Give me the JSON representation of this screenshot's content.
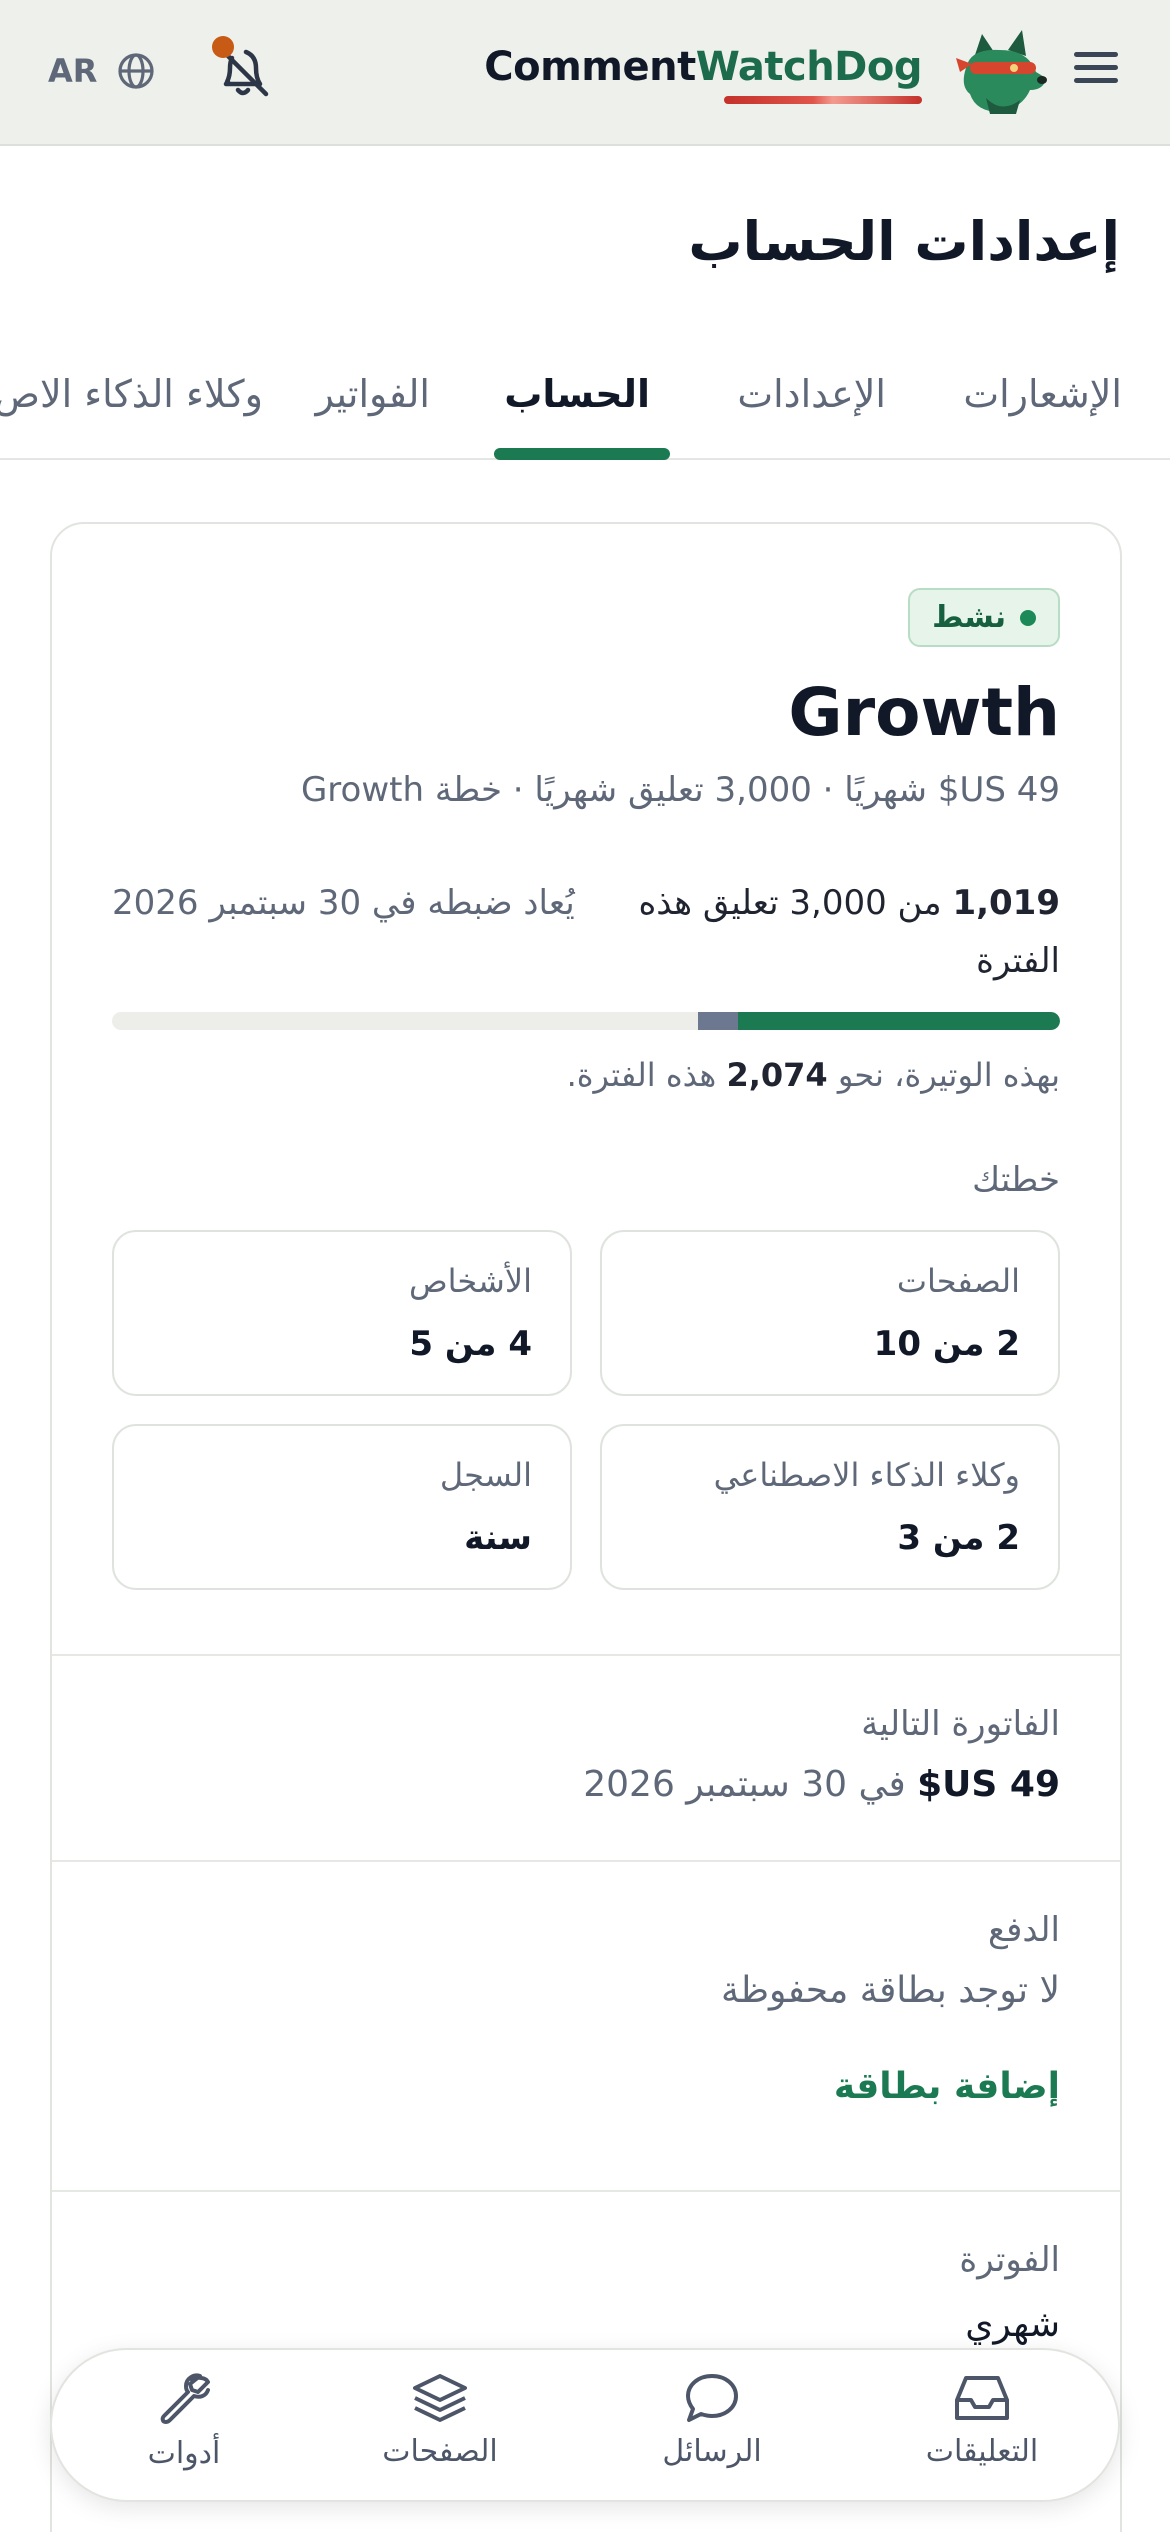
{
  "header": {
    "brand_part1": "Comment",
    "brand_part2": "WatchDog",
    "language": "AR"
  },
  "page_title": "إعدادات الحساب",
  "tabs": [
    {
      "label": "الإشعارات",
      "active": false
    },
    {
      "label": "الإعدادات",
      "active": false
    },
    {
      "label": "الحساب",
      "active": true
    },
    {
      "label": "الفواتير",
      "active": false
    },
    {
      "label": "وكلاء الذكاء الاص",
      "active": false
    }
  ],
  "plan": {
    "status": "نشط",
    "name": "Growth",
    "description": "49 US$ شهريًا · 3,000 تعليق شهريًا · خطة Growth",
    "usage_used": "1,019",
    "usage_rest": " من 3,000 تعليق هذه الفترة",
    "reset_text": "يُعاد ضبطه في 30 سبتمبر 2026",
    "usage_fraction": 0.3397,
    "pace_fraction": 0.691,
    "pace_prefix": "بهذه الوتيرة، نحو ",
    "pace_value": "2,074",
    "pace_suffix": " هذه الفترة.",
    "your_plan_label": "خطتك",
    "tiles": [
      {
        "label": "الصفحات",
        "value": "2 من 10"
      },
      {
        "label": "الأشخاص",
        "value": "4 من 5"
      },
      {
        "label": "وكلاء الذكاء الاصطناعي",
        "value": "2 من 3"
      },
      {
        "label": "السجل",
        "value": "سنة"
      }
    ]
  },
  "next_invoice": {
    "label": "الفاتورة التالية",
    "amount": "49 US$",
    "date": " في 30 سبتمبر 2026"
  },
  "payment": {
    "label": "الدفع",
    "value": "لا توجد بطاقة محفوظة",
    "add_card": "إضافة بطاقة"
  },
  "billing": {
    "label": "الفوترة",
    "value": "شهري"
  },
  "bottom_nav": [
    {
      "label": "التعليقات",
      "icon": "inbox-icon"
    },
    {
      "label": "الرسائل",
      "icon": "chat-bubble-icon"
    },
    {
      "label": "الصفحات",
      "icon": "layers-icon"
    },
    {
      "label": "أدوات",
      "icon": "wrench-icon"
    }
  ],
  "colors": {
    "accent": "#1b7a52",
    "topbar_bg": "#eef0ec",
    "notification_dot": "#c75a14",
    "brand_underline": "#c4312a"
  }
}
